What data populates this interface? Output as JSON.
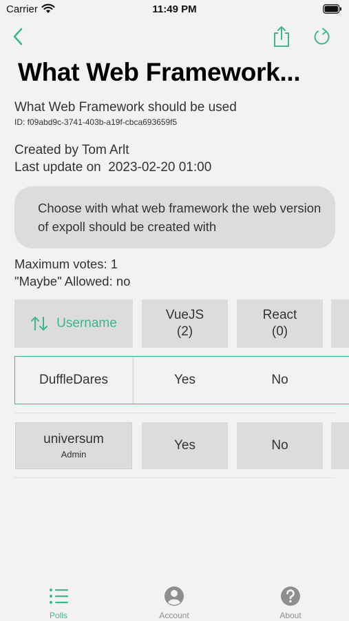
{
  "status_bar": {
    "carrier": "Carrier",
    "time": "11:49 PM"
  },
  "nav": {
    "back_icon": "chevron-left-icon",
    "share_icon": "share-icon",
    "refresh_icon": "refresh-icon"
  },
  "poll": {
    "title": "What Web Framework...",
    "description": "What Web Framework should be used",
    "id_text": "ID: f09abd9c-3741-403b-a19f-cbca693659f5",
    "created_by": "Created by Tom Arlt",
    "last_update": "Last update on  2023-02-20 01:00",
    "info": "Choose with what web framework the web version of expoll should be created with",
    "max_votes": "Maximum votes: 1",
    "maybe_allowed": "\"Maybe\" Allowed: no"
  },
  "table": {
    "username_header": "Username",
    "options": [
      {
        "name": "VueJS",
        "count": "(2)"
      },
      {
        "name": "React",
        "count": "(0)"
      }
    ],
    "rows": [
      {
        "name": "DuffleDares",
        "role": "",
        "votes": [
          "Yes",
          "No"
        ]
      },
      {
        "name": "universum",
        "role": "Admin",
        "votes": [
          "Yes",
          "No"
        ]
      }
    ]
  },
  "tabs": [
    {
      "label": "Polls",
      "icon": "list-icon",
      "active": true
    },
    {
      "label": "Account",
      "icon": "person-circle-icon",
      "active": false
    },
    {
      "label": "About",
      "icon": "question-circle-icon",
      "active": false
    }
  ],
  "colors": {
    "accent": "#3db68a",
    "background": "#f2f2f2",
    "cell": "#dcdcdc"
  }
}
